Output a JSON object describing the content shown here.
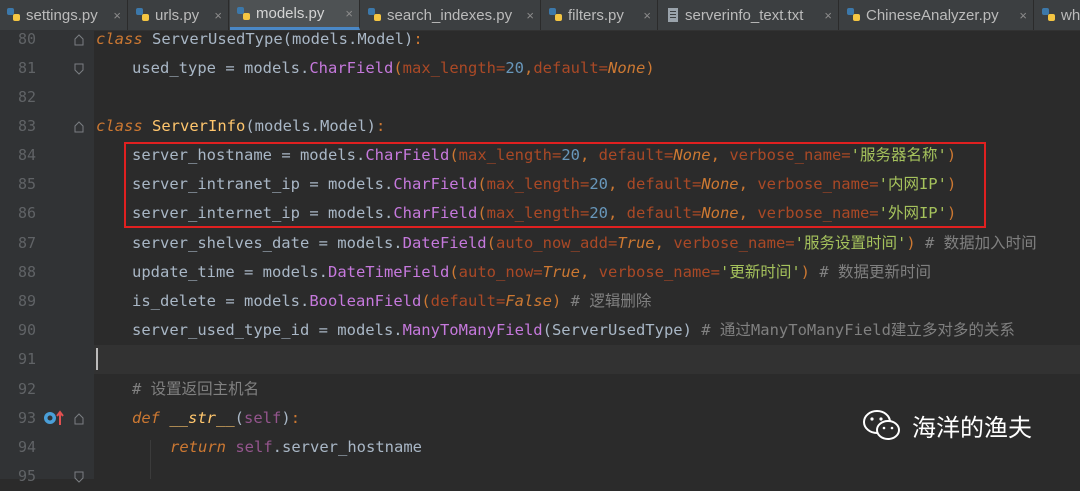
{
  "tabs": [
    {
      "label": "settings.py",
      "active": false,
      "icon": "python-file-icon"
    },
    {
      "label": "urls.py",
      "active": false,
      "icon": "python-file-icon"
    },
    {
      "label": "models.py",
      "active": true,
      "icon": "python-file-icon"
    },
    {
      "label": "search_indexes.py",
      "active": false,
      "icon": "python-file-icon"
    },
    {
      "label": "filters.py",
      "active": false,
      "icon": "python-file-icon"
    },
    {
      "label": "serverinfo_text.txt",
      "active": false,
      "icon": "text-file-icon"
    },
    {
      "label": "ChineseAnalyzer.py",
      "active": false,
      "icon": "python-file-icon"
    },
    {
      "label": "wh",
      "active": false,
      "icon": "python-file-icon"
    }
  ],
  "close_glyph": "×",
  "lines": {
    "n80": "80",
    "n81": "81",
    "n82": "82",
    "n83": "83",
    "n84": "84",
    "n85": "85",
    "n86": "86",
    "n87": "87",
    "n88": "88",
    "n89": "89",
    "n90": "90",
    "n91": "91",
    "n92": "92",
    "n93": "93",
    "n94": "94",
    "n95": "95"
  },
  "code": {
    "l80": {
      "kw": "class",
      "name": "ServerUsedType",
      "base": "(models.Model)",
      "colon": ":"
    },
    "l81": {
      "var": "used_type",
      "eq": " = models.",
      "fn": "CharField",
      "open": "(",
      "p1": "max_length=",
      "v1": "20",
      "c1": ",",
      "p2": "default=",
      "v2": "None",
      "close": ")"
    },
    "l83": {
      "kw": "class",
      "name": "ServerInfo",
      "base": "(models.Model)",
      "colon": ":"
    },
    "l84": {
      "var": "server_hostname",
      "eq": " = models.",
      "fn": "CharField",
      "open": "(",
      "p1": "max_length=",
      "v1": "20",
      "c1": ", ",
      "p2": "default=",
      "v2": "None",
      "c2": ", ",
      "p3": "verbose_name=",
      "s": "'服务器名称'",
      "close": ")"
    },
    "l85": {
      "var": "server_intranet_ip",
      "eq": " = models.",
      "fn": "CharField",
      "open": "(",
      "p1": "max_length=",
      "v1": "20",
      "c1": ", ",
      "p2": "default=",
      "v2": "None",
      "c2": ", ",
      "p3": "verbose_name=",
      "s": "'内网IP'",
      "close": ")"
    },
    "l86": {
      "var": "server_internet_ip",
      "eq": " = models.",
      "fn": "CharField",
      "open": "(",
      "p1": "max_length=",
      "v1": "20",
      "c1": ", ",
      "p2": "default=",
      "v2": "None",
      "c2": ", ",
      "p3": "verbose_name=",
      "s": "'外网IP'",
      "close": ")"
    },
    "l87": {
      "var": "server_shelves_date",
      "eq": " = models.",
      "fn": "DateField",
      "open": "(",
      "p1": "auto_now_add=",
      "v1": "True",
      "c1": ", ",
      "p2": "verbose_name=",
      "s": "'服务设置时间'",
      "close": ")",
      "cmt": " # 数据加入时间"
    },
    "l88": {
      "var": "update_time",
      "eq": " = models.",
      "fn": "DateTimeField",
      "open": "(",
      "p1": "auto_now=",
      "v1": "True",
      "c1": ", ",
      "p2": "verbose_name=",
      "s": "'更新时间'",
      "close": ")",
      "cmt": " # 数据更新时间"
    },
    "l89": {
      "var": "is_delete",
      "eq": " = models.",
      "fn": "BooleanField",
      "open": "(",
      "p1": "default=",
      "v1": "False",
      "close": ")",
      "cmt": " # 逻辑删除"
    },
    "l90": {
      "var": "server_used_type_id",
      "eq": " = models.",
      "fn": "ManyToManyField",
      "args": "(ServerUsedType)",
      "cmt": " # 通过ManyToManyField建立多对多的关系"
    },
    "l92": {
      "cmt": "# 设置返回主机名"
    },
    "l93": {
      "kw": "def",
      "name": "__str__",
      "open": "(",
      "self": "self",
      "close": ")",
      "colon": ":"
    },
    "l94": {
      "kw": "return",
      "self": "self",
      "rest": ".server_hostname"
    }
  },
  "watermark": {
    "text": "海洋的渔夫",
    "icon": "wechat-icon"
  },
  "colors": {
    "highlight_box": "#e02020",
    "background": "#2b2b2b",
    "keyword": "#cc7832",
    "string": "#a5c25c"
  }
}
